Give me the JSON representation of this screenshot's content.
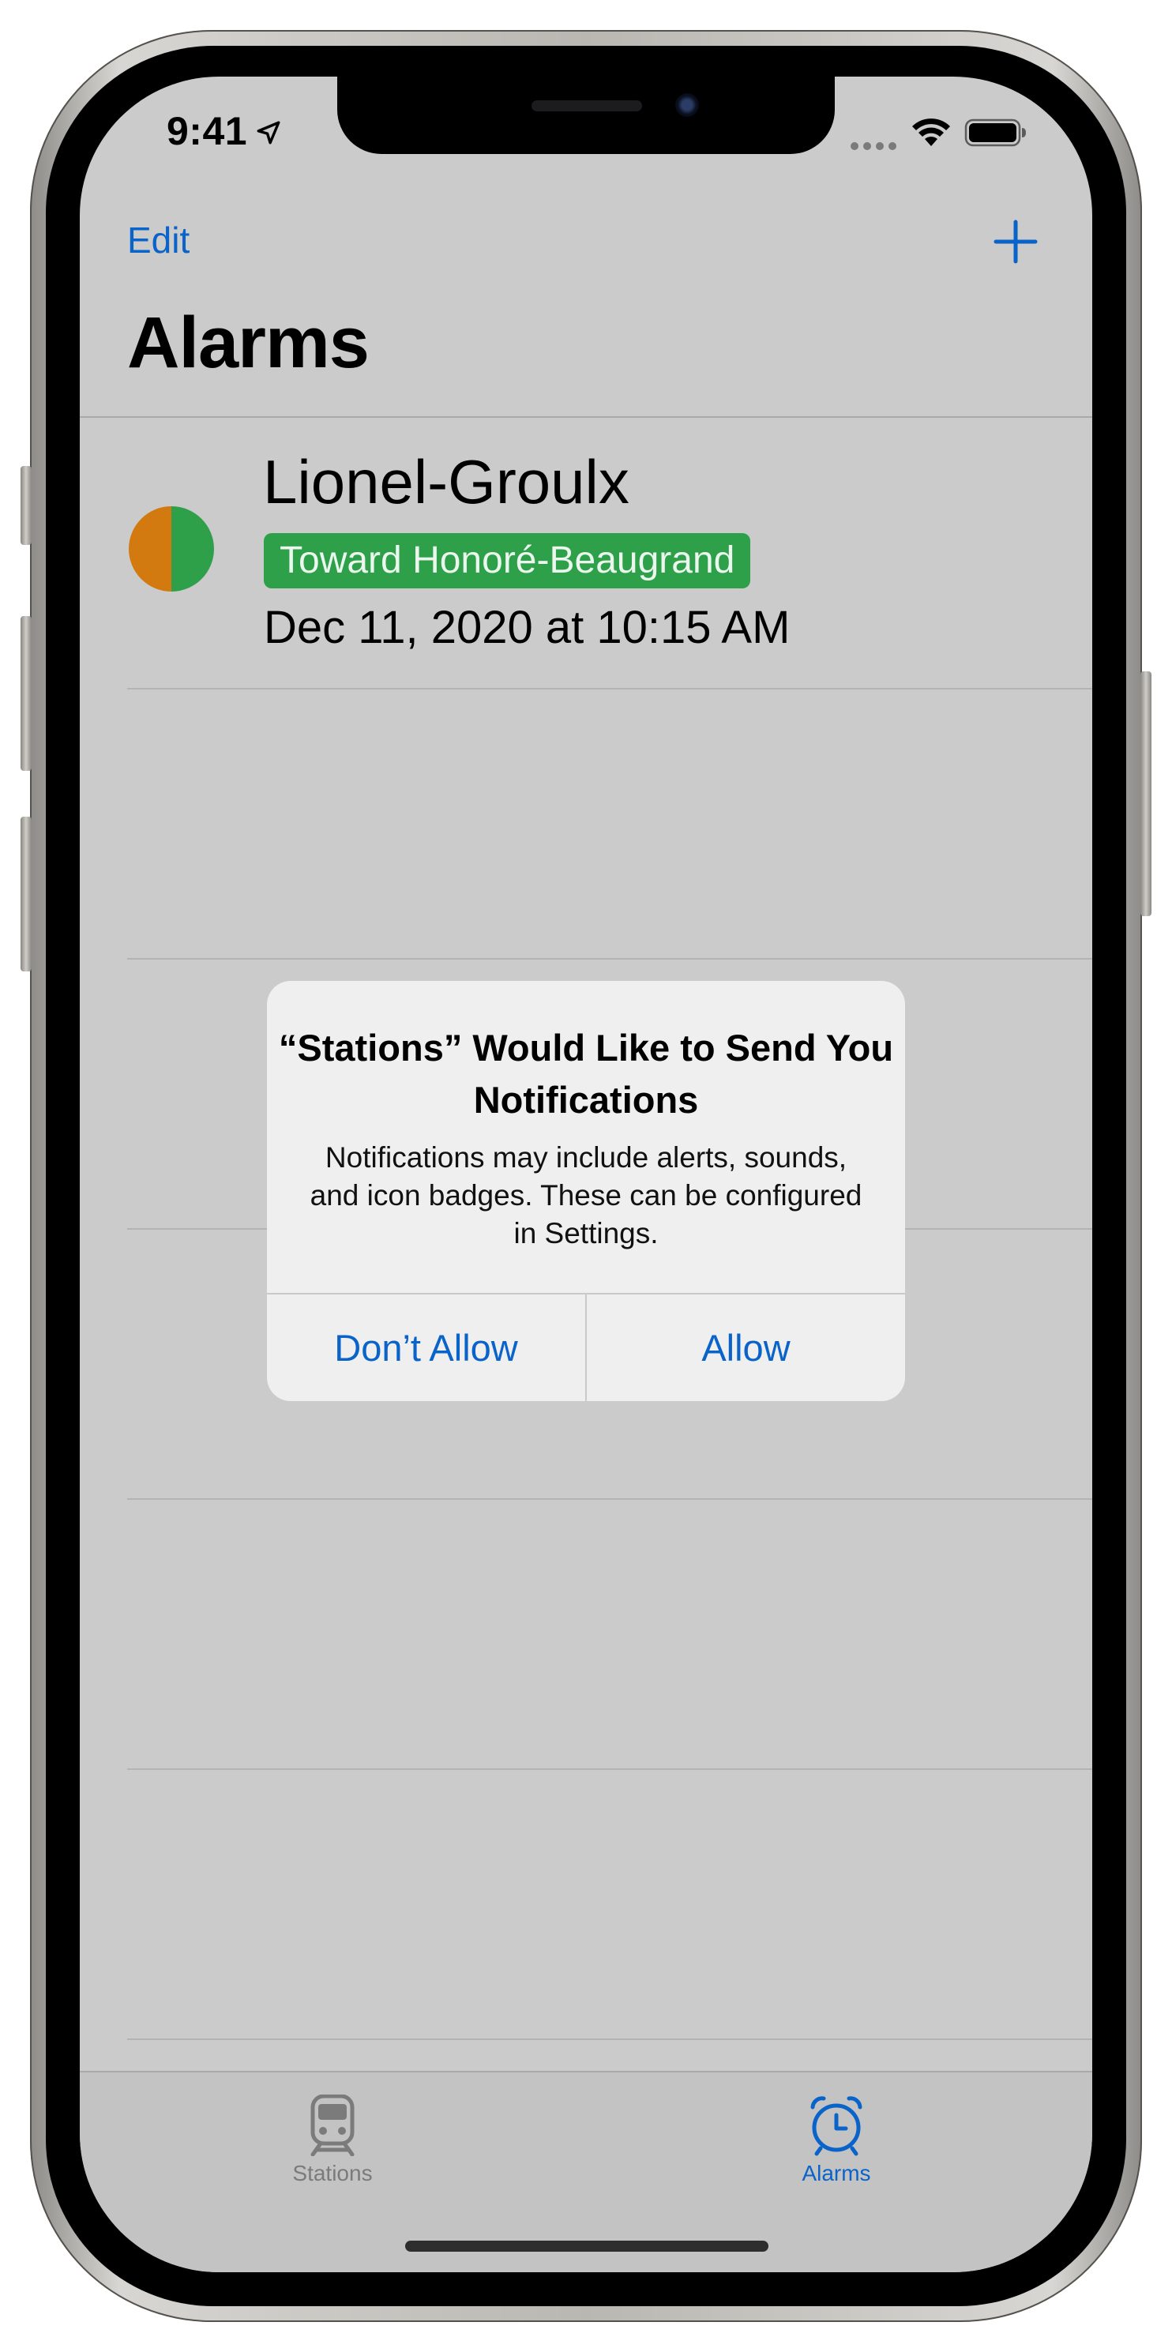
{
  "status_bar": {
    "time": "9:41",
    "icons": [
      "location-arrow-icon",
      "signal-dots-icon",
      "wifi-icon",
      "battery-icon"
    ]
  },
  "nav": {
    "edit_label": "Edit",
    "add_icon": "plus-icon",
    "title": "Alarms"
  },
  "alarms": [
    {
      "station": "Lionel-Groulx",
      "direction": "Toward Honoré-Beaugrand",
      "datetime": "Dec 11, 2020 at 10:15 AM",
      "line_colors": [
        "#d27a10",
        "#2ea049"
      ]
    }
  ],
  "alert": {
    "title": "“Stations” Would Like to Send You Notifications",
    "message": "Notifications may include alerts, sounds, and icon badges. These can be configured in Settings.",
    "deny_label": "Don’t Allow",
    "allow_label": "Allow"
  },
  "tabs": [
    {
      "label": "Stations",
      "icon": "train-icon",
      "selected": false
    },
    {
      "label": "Alarms",
      "icon": "alarm-clock-icon",
      "selected": true
    }
  ],
  "colors": {
    "accent": "#0a63c9",
    "badge_green": "#2ea049",
    "line_orange": "#d27a10",
    "screen_dimmed": "#cbcbcb",
    "tab_inactive": "#7b7b7b"
  }
}
